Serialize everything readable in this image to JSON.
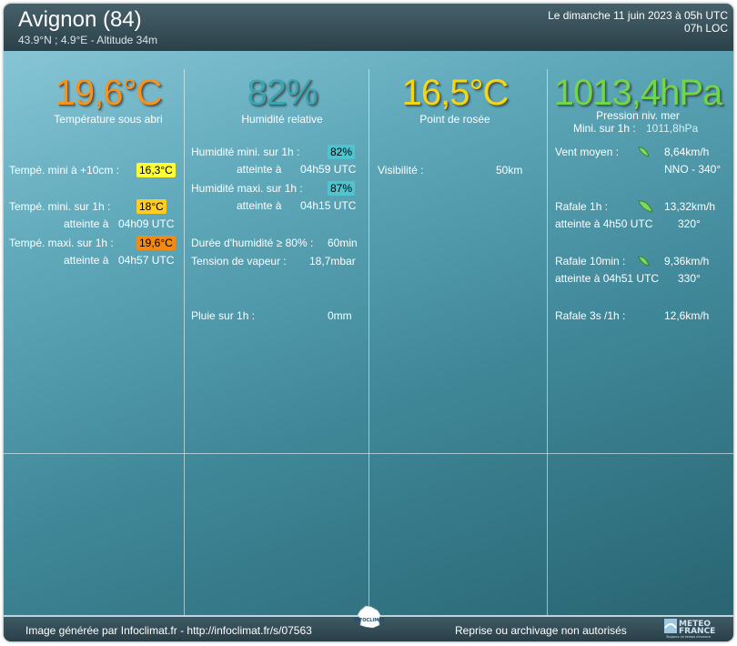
{
  "header": {
    "station": "Avignon (84)",
    "coords": "43.9°N ; 4.9°E - Altitude 34m",
    "date_line1": "Le dimanche 11 juin 2023 à 05h UTC",
    "date_line2": "07h LOC"
  },
  "big": {
    "temperature": "19,6°C",
    "temperature_label": "Température sous abri",
    "humidity": "82%",
    "humidity_label": "Humidité relative",
    "dewpoint": "16,5°C",
    "dewpoint_label": "Point de rosée",
    "pressure": "1013,4hPa",
    "pressure_label": "Pression niv. mer",
    "pressure_min_label": "Mini. sur 1h :",
    "pressure_min_value": "1011,8hPa"
  },
  "colors": {
    "temperature": "#f5931e",
    "humidity": "#3aa6b4",
    "dewpoint": "#f5d616",
    "pressure": "#6fd84a",
    "badge_yellow": "#ffff33",
    "badge_amber": "#ffcc22",
    "badge_orange": "#f58a12",
    "badge_cyan": "#4fc4cf"
  },
  "col1": {
    "min10_label": "Tempé. mini à +10cm :",
    "min10_value": "16,3°C",
    "min1h_label": "Tempé. mini. sur 1h :",
    "min1h_value": "18°C",
    "min1h_at_label": "atteinte à",
    "min1h_at_value": "04h09 UTC",
    "max1h_label": "Tempé. maxi. sur 1h :",
    "max1h_value": "19,6°C",
    "max1h_at_label": "atteinte à",
    "max1h_at_value": "04h57 UTC"
  },
  "col2": {
    "hmin_label": "Humidité mini. sur 1h :",
    "hmin_value": "82%",
    "hmin_at_label": "atteinte à",
    "hmin_at_value": "04h59 UTC",
    "hmax_label": "Humidité maxi. sur 1h :",
    "hmax_value": "87%",
    "hmax_at_label": "atteinte à",
    "hmax_at_value": "04h15 UTC",
    "duration_label": "Durée d'humidité ≥ 80% :",
    "duration_value": "60min",
    "vapour_label": "Tension de vapeur :",
    "vapour_value": "18,7mbar",
    "rain_label": "Pluie sur 1h :",
    "rain_value": "0mm"
  },
  "col3": {
    "visibility_label": "Visibilité :",
    "visibility_value": "50km"
  },
  "col4": {
    "wind_label": "Vent moyen :",
    "wind_value": "8,64km/h",
    "wind_dir": "NNO - 340°",
    "gust1h_label": "Rafale 1h :",
    "gust1h_value": "13,32km/h",
    "gust1h_at": "atteinte à 4h50 UTC",
    "gust1h_dir": "320°",
    "gust10_label": "Rafale 10min :",
    "gust10_value": "9,36km/h",
    "gust10_at": "atteinte à 04h51 UTC",
    "gust10_dir": "330°",
    "gust3s_label": "Rafale 3s /1h :",
    "gust3s_value": "12,6km/h"
  },
  "footer": {
    "generated": "Image générée par Infoclimat.fr - http://infoclimat.fr/s/07563",
    "rights": "Reprise ou archivage non autorisés",
    "france_logo_text": "INFOCLIMAT",
    "meteo_logo_text": "METEO FRANCE",
    "meteo_logo_tagline": "Toujours un temps d'avance"
  }
}
